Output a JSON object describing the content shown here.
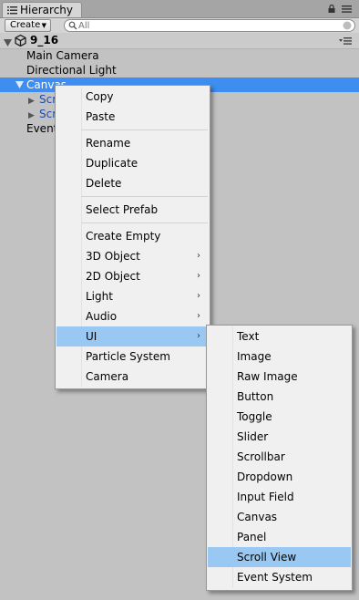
{
  "window": {
    "tab_title": "Hierarchy"
  },
  "toolbar": {
    "create_label": "Create",
    "search_placeholder": "All"
  },
  "scene": {
    "name": "9_16"
  },
  "tree": [
    {
      "label": "Main Camera"
    },
    {
      "label": "Directional Light"
    },
    {
      "label": "Canvas"
    },
    {
      "label": "Scr"
    },
    {
      "label": "Scr"
    },
    {
      "label": "Event"
    }
  ],
  "context_menu": {
    "items": [
      {
        "label": "Copy"
      },
      {
        "label": "Paste"
      },
      {
        "label": "Rename"
      },
      {
        "label": "Duplicate"
      },
      {
        "label": "Delete"
      },
      {
        "label": "Select Prefab"
      },
      {
        "label": "Create Empty"
      },
      {
        "label": "3D Object",
        "submenu": true
      },
      {
        "label": "2D Object",
        "submenu": true
      },
      {
        "label": "Light",
        "submenu": true
      },
      {
        "label": "Audio",
        "submenu": true
      },
      {
        "label": "UI",
        "submenu": true,
        "highlighted": true
      },
      {
        "label": "Particle System"
      },
      {
        "label": "Camera"
      }
    ],
    "chevron": "›"
  },
  "ui_submenu": {
    "items": [
      {
        "label": "Text"
      },
      {
        "label": "Image"
      },
      {
        "label": "Raw Image"
      },
      {
        "label": "Button"
      },
      {
        "label": "Toggle"
      },
      {
        "label": "Slider"
      },
      {
        "label": "Scrollbar"
      },
      {
        "label": "Dropdown"
      },
      {
        "label": "Input Field"
      },
      {
        "label": "Canvas"
      },
      {
        "label": "Panel"
      },
      {
        "label": "Scroll View",
        "highlighted": true
      },
      {
        "label": "Event System"
      }
    ]
  },
  "colors": {
    "selection": "#3d8ef0",
    "menu_highlight": "#99c9f3",
    "panel_bg": "#c2c2c2"
  }
}
